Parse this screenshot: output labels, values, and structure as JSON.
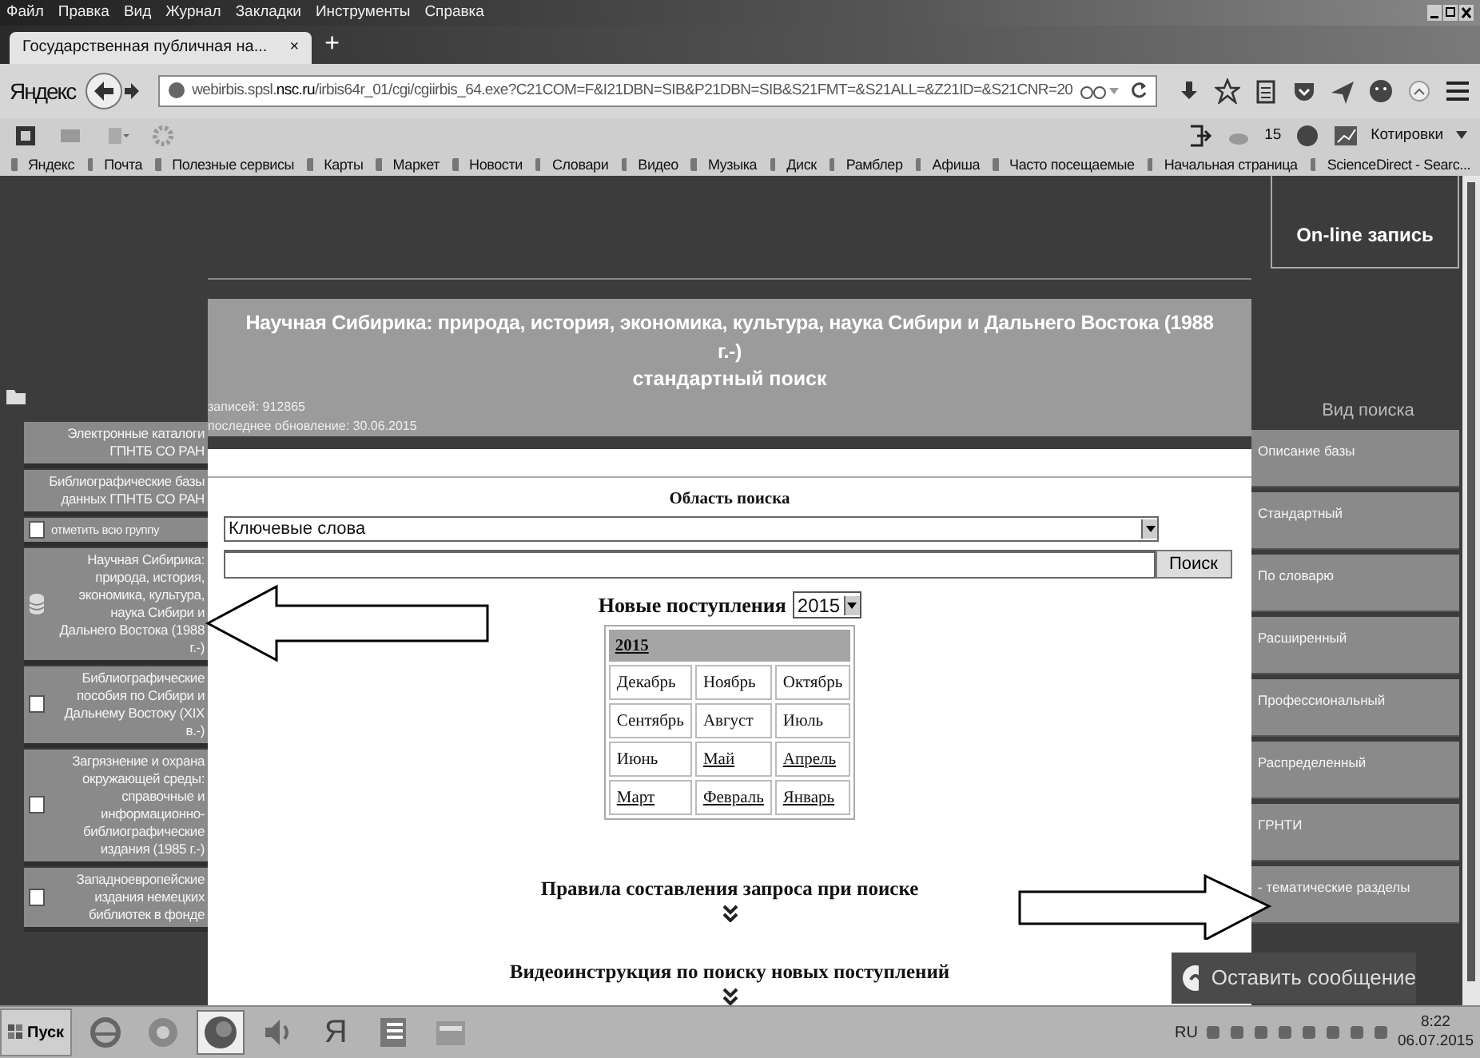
{
  "menu_bar": {
    "items": [
      "Файл",
      "Правка",
      "Вид",
      "Журнал",
      "Закладки",
      "Инструменты",
      "Справка"
    ]
  },
  "browser": {
    "tabs": [
      {
        "title": "Государственная публичная на...",
        "close": "×",
        "selected": true
      }
    ],
    "new_tab": "+",
    "brand": "Яндекс",
    "url": "webirbis.spsl.**nsc.ru**/irbis64r_01/cgi/cgiirbis_64.exe?C21COM=F&I21DBN=SIB&P21DBN=SIB&S21FMT=&S21ALL=&Z21ID=&S21CNR=20",
    "toolbar": {
      "count": "15",
      "quotes": "Котировки"
    },
    "bookmarks": [
      "Яндекс",
      "Почта",
      "Полезные сервисы",
      "Карты",
      "Маркет",
      "Новости",
      "Словари",
      "Видео",
      "Музыка",
      "Диск",
      "Рамблер",
      "Афиша",
      "Часто посещаемые",
      "Начальная страница",
      "ScienceDirect - Searc..."
    ]
  },
  "page": {
    "header": {
      "title": "Научная Сибирика: природа, история, экономика, культура, наука Сибири и Дальнего Востока (1988 г.-)",
      "subtitle": "стандартный поиск",
      "records": "записей: 912865",
      "updated": "последнее обновление: 30.06.2015"
    },
    "sidebar": {
      "items": [
        {
          "kind": "heading",
          "label": "Электронные каталоги ГПНТБ СО РАН"
        },
        {
          "kind": "heading",
          "label": "Библиографические базы данных ГПНТБ СО РАН"
        },
        {
          "kind": "group",
          "label": "отметить всю группу",
          "checked": false
        },
        {
          "kind": "database",
          "label": "Научная Сибирика: природа, история, экономика, культура, наука Сибири и Дальнего Востока (1988 г.-)"
        },
        {
          "kind": "checkbox",
          "label": "Библиографические пособия по Сибири и Дальнему Востоку (XIX в.-)",
          "checked": false
        },
        {
          "kind": "checkbox",
          "label": "Загрязнение и охрана окружающей среды: справочные и информационно-библиографические издания (1985 г.-)",
          "checked": false
        },
        {
          "kind": "checkbox",
          "label": "Западноевропейские издания немецких библиотек в фонде",
          "checked": false
        }
      ]
    },
    "search": {
      "area_label": "Область поиска",
      "area_value": "Ключевые слова",
      "button": "Поиск"
    },
    "new_arrivals": {
      "label": "Новые поступления",
      "year": "2015",
      "table_year": "2015",
      "months": [
        {
          "name": "Декабрь",
          "link": false
        },
        {
          "name": "Ноябрь",
          "link": false
        },
        {
          "name": "Октябрь",
          "link": false
        },
        {
          "name": "Сентябрь",
          "link": false
        },
        {
          "name": "Август",
          "link": false
        },
        {
          "name": "Июль",
          "link": false
        },
        {
          "name": "Июнь",
          "link": false
        },
        {
          "name": "Май",
          "link": true
        },
        {
          "name": "Апрель",
          "link": true
        },
        {
          "name": "Март",
          "link": true
        },
        {
          "name": "Февраль",
          "link": true
        },
        {
          "name": "Январь",
          "link": true
        }
      ]
    },
    "sections": [
      "Правила составления запроса при поиске",
      "Видеоинструкция по поиску новых поступлений"
    ],
    "online_booking": "On-line запись",
    "search_types": {
      "title": "Вид поиска",
      "items": [
        "Описание базы",
        "Стандартный",
        "По словарю",
        "Расширенный",
        "Профессиональный",
        "Распределенный",
        "ГРНТИ",
        "- тематические разделы"
      ]
    },
    "chat": "Оставить сообщение"
  },
  "taskbar": {
    "start": "Пуск",
    "apps": [
      {
        "kind": "ie",
        "active": false
      },
      {
        "kind": "chrome",
        "active": false
      },
      {
        "kind": "firefox",
        "active": true
      },
      {
        "kind": "sound",
        "active": false
      },
      {
        "kind": "yandex",
        "glyph": "Я",
        "active": false
      },
      {
        "kind": "word",
        "active": false
      },
      {
        "kind": "files",
        "active": false
      }
    ],
    "language": "RU",
    "time": "8:22",
    "date": "06.07.2015"
  }
}
